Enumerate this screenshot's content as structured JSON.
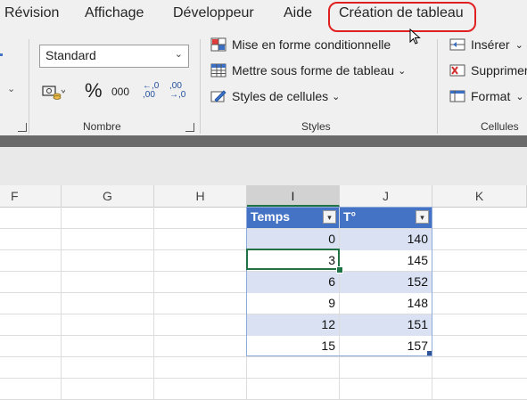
{
  "tabs": [
    "Révision",
    "Affichage",
    "Développeur",
    "Aide",
    "Création de tableau"
  ],
  "ribbon": {
    "number_format": "Standard",
    "percent_symbol": "%",
    "thousands_symbol": "000",
    "decimal_increase": "←,0 ,00",
    "decimal_decrease": ",00 →,0",
    "styles": {
      "conditional": "Mise en forme conditionnelle",
      "as_table": "Mettre sous forme de tableau",
      "cell_styles": "Styles de cellules"
    },
    "cells": {
      "insert": "Insérer",
      "delete": "Supprimer",
      "format": "Format"
    },
    "groups": {
      "number": "Nombre",
      "styles": "Styles",
      "cells": "Cellules"
    },
    "chevron": "⌄"
  },
  "columns": [
    "F",
    "G",
    "H",
    "I",
    "J",
    "K"
  ],
  "table": {
    "headers": [
      "Temps",
      "T°"
    ],
    "filter_glyph": "▾",
    "rows": [
      [
        "0",
        "140"
      ],
      [
        "3",
        "145"
      ],
      [
        "6",
        "152"
      ],
      [
        "9",
        "148"
      ],
      [
        "12",
        "151"
      ],
      [
        "15",
        "157"
      ]
    ]
  },
  "colors": {
    "table_header": "#4472c4",
    "band": "#d9e1f2",
    "selection": "#217346",
    "highlight": "#e02020"
  },
  "icons": [
    "mouse-pointer-icon",
    "accounting-format-icon",
    "percent-icon",
    "conditional-format-icon",
    "table-format-icon",
    "cell-styles-icon",
    "insert-icon",
    "delete-icon",
    "format-icon",
    "dialog-launcher-icon",
    "filter-dropdown-icon"
  ]
}
